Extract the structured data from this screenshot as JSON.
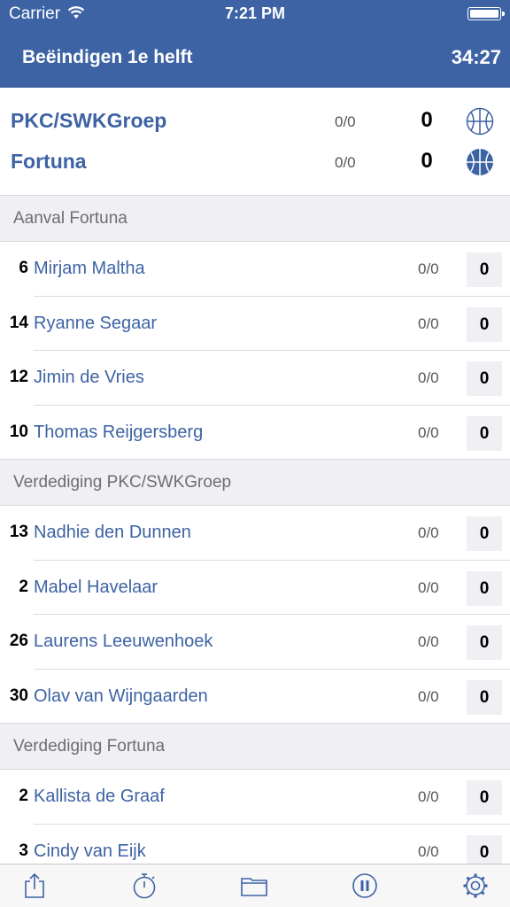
{
  "status_bar": {
    "carrier": "Carrier",
    "time": "7:21 PM"
  },
  "nav": {
    "end_half_label": "Beëindigen 1e helft",
    "clock": "34:27"
  },
  "teams": {
    "home": {
      "name": "PKC/SWKGroep",
      "stat": "0/0",
      "score": "0",
      "icon": "basketball-outline-icon"
    },
    "away": {
      "name": "Fortuna",
      "stat": "0/0",
      "score": "0",
      "icon": "basketball-filled-icon"
    }
  },
  "sections": [
    {
      "title": "Aanval Fortuna",
      "players": [
        {
          "number": "6",
          "name": "Mirjam Maltha",
          "stat": "0/0",
          "goals": "0"
        },
        {
          "number": "14",
          "name": "Ryanne Segaar",
          "stat": "0/0",
          "goals": "0"
        },
        {
          "number": "12",
          "name": "Jimin de Vries",
          "stat": "0/0",
          "goals": "0"
        },
        {
          "number": "10",
          "name": "Thomas Reijgersberg",
          "stat": "0/0",
          "goals": "0"
        }
      ]
    },
    {
      "title": "Verdediging PKC/SWKGroep",
      "players": [
        {
          "number": "13",
          "name": "Nadhie den Dunnen",
          "stat": "0/0",
          "goals": "0"
        },
        {
          "number": "2",
          "name": "Mabel Havelaar",
          "stat": "0/0",
          "goals": "0"
        },
        {
          "number": "26",
          "name": "Laurens Leeuwenhoek",
          "stat": "0/0",
          "goals": "0"
        },
        {
          "number": "30",
          "name": "Olav van Wijngaarden",
          "stat": "0/0",
          "goals": "0"
        }
      ]
    },
    {
      "title": "Verdediging Fortuna",
      "players": [
        {
          "number": "2",
          "name": "Kallista de Graaf",
          "stat": "0/0",
          "goals": "0"
        },
        {
          "number": "3",
          "name": "Cindy van Eijk",
          "stat": "0/0",
          "goals": "0"
        }
      ]
    }
  ],
  "tab_bar": {
    "icons": [
      "share-icon",
      "stopwatch-icon",
      "folder-icon",
      "pause-icon",
      "settings-gear-icon"
    ]
  },
  "colors": {
    "brand_blue": "#3d63a4",
    "section_bg": "#efeff4"
  }
}
